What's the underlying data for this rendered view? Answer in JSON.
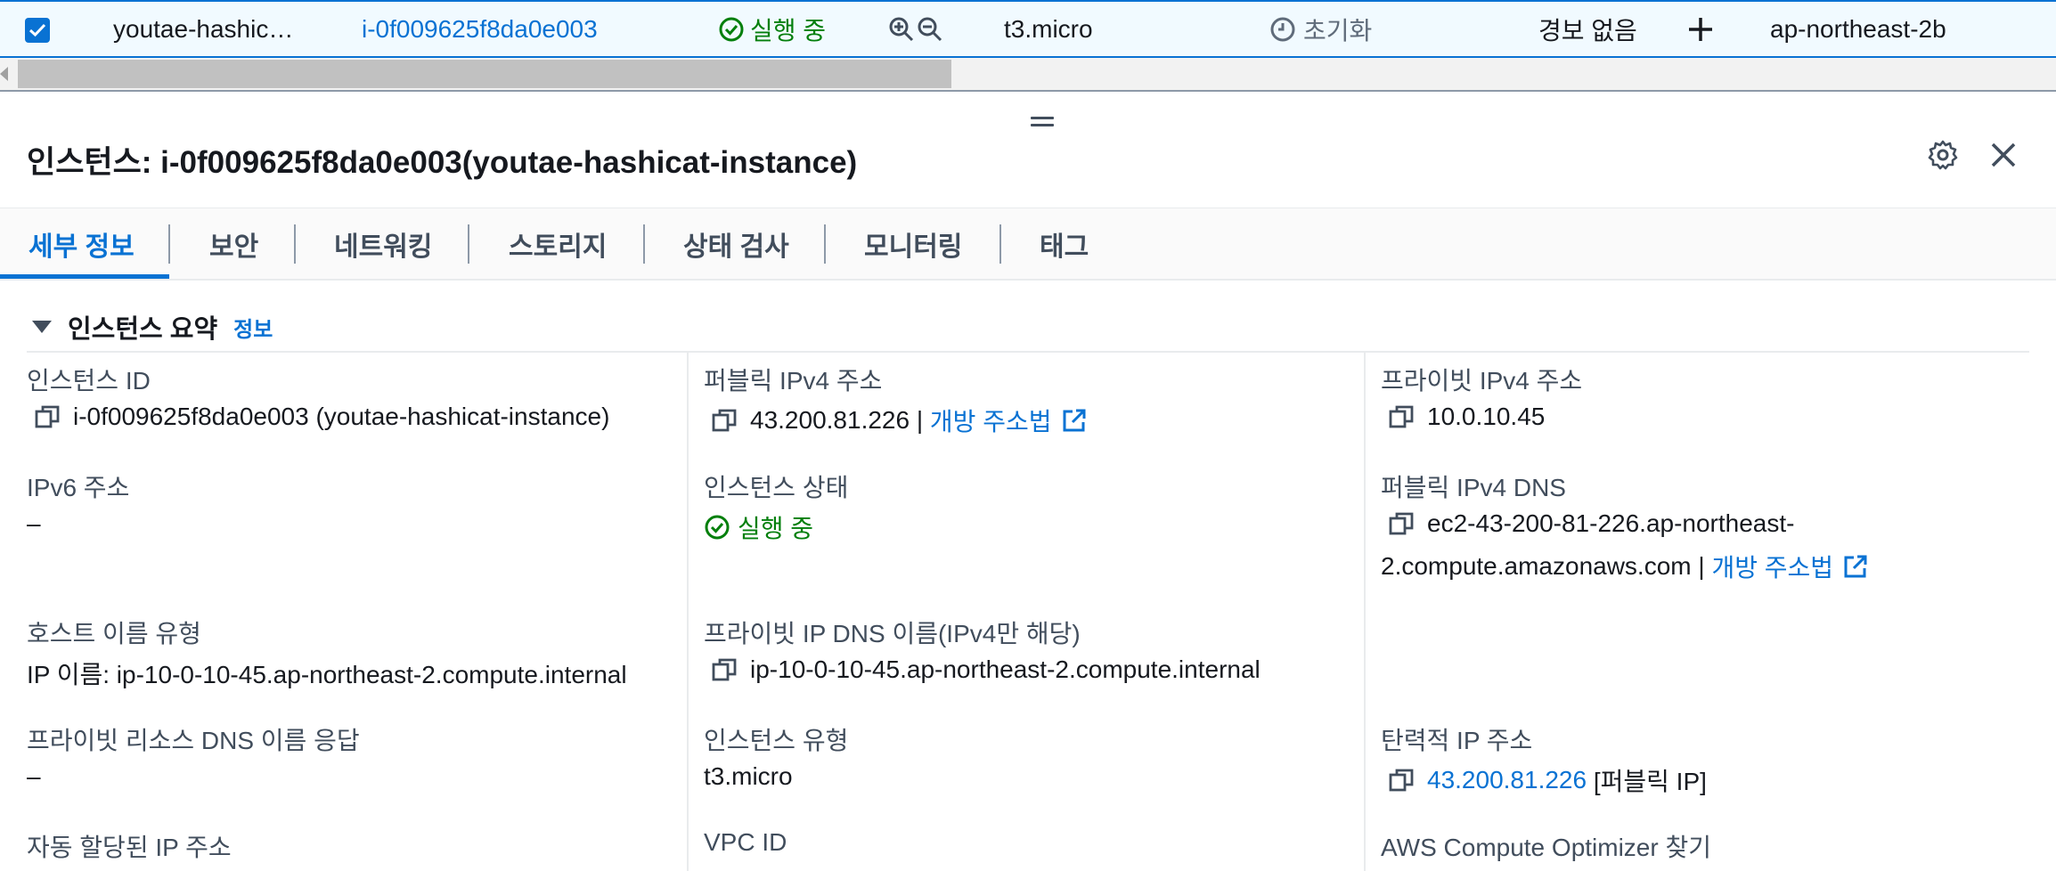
{
  "row": {
    "name": "youtae-hashic…",
    "instance_id": "i-0f009625f8da0e003",
    "state": "실행 중",
    "instance_type": "t3.micro",
    "status_check": "초기화",
    "alarm": "경보 없음",
    "plus": "+",
    "az": "ap-northeast-2b"
  },
  "panel": {
    "title": "인스턴스: i-0f009625f8da0e003(youtae-hashicat-instance)"
  },
  "tabs": [
    {
      "label": "세부 정보"
    },
    {
      "label": "보안"
    },
    {
      "label": "네트워킹"
    },
    {
      "label": "스토리지"
    },
    {
      "label": "상태 검사"
    },
    {
      "label": "모니터링"
    },
    {
      "label": "태그"
    }
  ],
  "section": {
    "title": "인스턴스 요약",
    "info": "정보"
  },
  "fields": {
    "instance_id_label": "인스턴스 ID",
    "instance_id_value": "i-0f009625f8da0e003 (youtae-hashicat-instance)",
    "public_ipv4_label": "퍼블릭 IPv4 주소",
    "public_ipv4_value": "43.200.81.226",
    "public_ipv4_sep": " | ",
    "open_address": "개방 주소법",
    "private_ipv4_label": "프라이빗 IPv4 주소",
    "private_ipv4_value": "10.0.10.45",
    "ipv6_label": "IPv6 주소",
    "ipv6_value": "–",
    "instance_state_label": "인스턴스 상태",
    "instance_state_value": "실행 중",
    "public_dns_label": "퍼블릭 IPv4 DNS",
    "public_dns_line1": "ec2-43-200-81-226.ap-northeast-",
    "public_dns_line2": "2.compute.amazonaws.com",
    "public_dns_sep": " | ",
    "public_dns_open": "개방 주소법",
    "hostname_type_label": "호스트 이름 유형",
    "hostname_type_value": "IP 이름: ip-10-0-10-45.ap-northeast-2.compute.internal",
    "private_dns_label": "프라이빗 IP DNS 이름(IPv4만 해당)",
    "private_dns_value": "ip-10-0-10-45.ap-northeast-2.compute.internal",
    "private_resource_dns_label": "프라이빗 리소스 DNS 이름 응답",
    "private_resource_dns_value": "–",
    "instance_type_label": "인스턴스 유형",
    "instance_type_value": "t3.micro",
    "elastic_ip_label": "탄력적 IP 주소",
    "elastic_ip_value": "43.200.81.226",
    "elastic_ip_suffix": " [퍼블릭 IP]",
    "auto_ip_label": "자동 할당된 IP 주소",
    "vpc_id_label": "VPC ID",
    "compute_optimizer_label": "AWS Compute Optimizer 찾기"
  },
  "colors": {
    "link": "#0972d3",
    "success": "#037f0c",
    "selected_row_bg": "#f1faff"
  }
}
